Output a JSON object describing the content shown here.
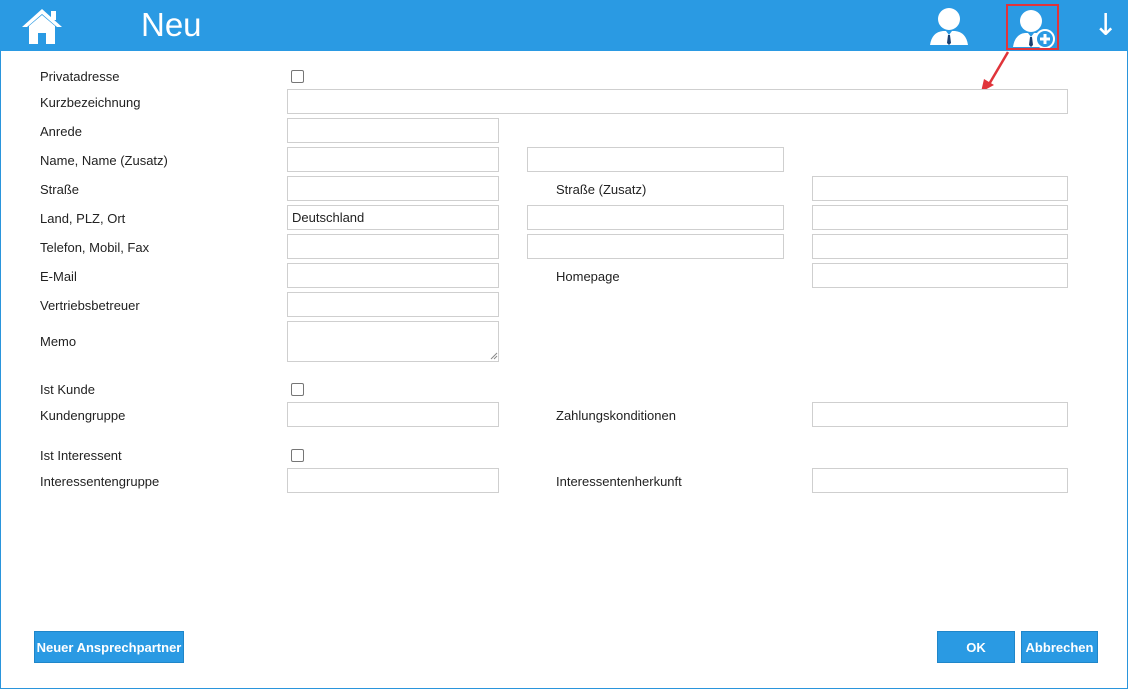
{
  "header": {
    "title": "Neu",
    "home_icon": "home-icon",
    "contact_icon": "person-icon",
    "add_contact_icon": "person-add-icon",
    "down_label": "↓"
  },
  "form": {
    "privatadresse_label": "Privatadresse",
    "kurzbezeichnung_label": "Kurzbezeichnung",
    "anrede_label": "Anrede",
    "name_label": "Name, Name (Zusatz)",
    "strasse_label": "Straße",
    "strasse_zusatz_label": "Straße (Zusatz)",
    "land_label": "Land, PLZ, Ort",
    "land_value": "Deutschland",
    "telefon_label": "Telefon, Mobil, Fax",
    "email_label": "E-Mail",
    "homepage_label": "Homepage",
    "vertriebsbetreuer_label": "Vertriebsbetreuer",
    "memo_label": "Memo",
    "ist_kunde_label": "Ist Kunde",
    "kundengruppe_label": "Kundengruppe",
    "zahlungskonditionen_label": "Zahlungskonditionen",
    "ist_interessent_label": "Ist Interessent",
    "interessentengruppe_label": "Interessentengruppe",
    "interessentenherkunft_label": "Interessentenherkunft"
  },
  "footer": {
    "new_contact_label": "Neuer Ansprechpartner",
    "ok_label": "OK",
    "cancel_label": "Abbrechen"
  },
  "colors": {
    "accent": "#2a9ae3",
    "highlight": "#e0343a"
  }
}
